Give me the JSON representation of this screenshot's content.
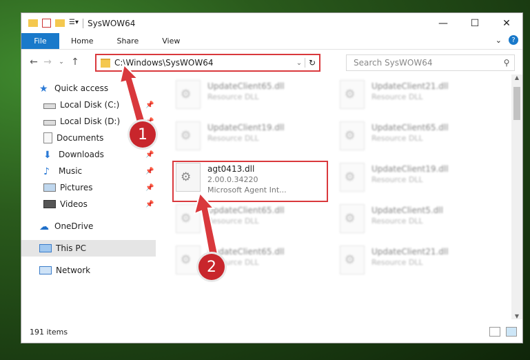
{
  "window": {
    "title": "SysWOW64"
  },
  "ribbon": {
    "tabs": [
      "File",
      "Home",
      "Share",
      "View"
    ]
  },
  "address": {
    "path": "C:\\Windows\\SysWOW64"
  },
  "search": {
    "placeholder": "Search SysWOW64"
  },
  "nav": {
    "items": [
      {
        "label": "Quick access",
        "icon": "star-icon",
        "pinned": false
      },
      {
        "label": "Local Disk (C:)",
        "icon": "drive-icon",
        "pinned": true
      },
      {
        "label": "Local Disk (D:)",
        "icon": "drive-icon",
        "pinned": true
      },
      {
        "label": "Documents",
        "icon": "documents-icon",
        "pinned": true
      },
      {
        "label": "Downloads",
        "icon": "download-icon",
        "pinned": true
      },
      {
        "label": "Music",
        "icon": "music-icon",
        "pinned": true
      },
      {
        "label": "Pictures",
        "icon": "pictures-icon",
        "pinned": true
      },
      {
        "label": "Videos",
        "icon": "videos-icon",
        "pinned": true
      },
      {
        "label": "OneDrive",
        "icon": "cloud-icon",
        "pinned": false
      },
      {
        "label": "This PC",
        "icon": "computer-icon",
        "pinned": false
      },
      {
        "label": "Network",
        "icon": "network-icon",
        "pinned": false
      }
    ]
  },
  "files": {
    "col1": [
      {
        "name": "UpdateClient65.dll",
        "desc": "Resource DLL"
      },
      {
        "name": "UpdateClient19.dll",
        "desc": "Resource DLL"
      },
      {
        "name": "agt0413.dll",
        "version": "2.00.0.34220",
        "desc": "Microsoft Agent Int..."
      },
      {
        "name": "UpdateClient65.dll",
        "desc": "Resource DLL"
      },
      {
        "name": "UpdateClient65.dll",
        "desc": "Resource DLL"
      }
    ],
    "col2": [
      {
        "name": "UpdateClient21.dll",
        "desc": "Resource DLL"
      },
      {
        "name": "UpdateClient65.dll",
        "desc": "Resource DLL"
      },
      {
        "name": "UpdateClient19.dll",
        "desc": "Resource DLL"
      },
      {
        "name": "UpdateClient5.dll",
        "desc": "Resource DLL"
      },
      {
        "name": "UpdateClient21.dll",
        "desc": "Resource DLL"
      }
    ]
  },
  "status": {
    "count": "191 items"
  },
  "annotations": {
    "step1": "1",
    "step2": "2"
  },
  "colors": {
    "accent": "#1979ca",
    "highlight": "#d9383c",
    "folder": "#f4c84f"
  }
}
